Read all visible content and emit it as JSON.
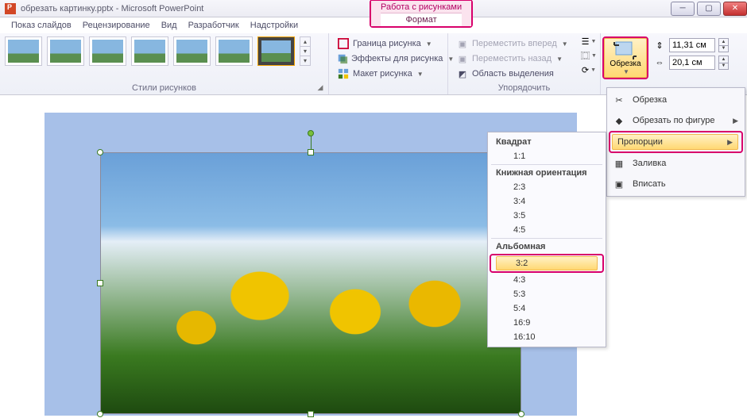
{
  "title": {
    "doc": "обрезать картинку.pptx",
    "app": "Microsoft PowerPoint",
    "sep": " - ",
    "contextual": "Работа с рисунками",
    "contextual_tab": "Формат"
  },
  "tabs": {
    "t1": "Показ слайдов",
    "t2": "Рецензирование",
    "t3": "Вид",
    "t4": "Разработчик",
    "t5": "Надстройки"
  },
  "ribbon": {
    "styles_label": "Стили рисунков",
    "arrange_label": "Упорядочить",
    "border": "Граница рисунка",
    "effects": "Эффекты для рисунка",
    "layout": "Макет рисунка",
    "bring_fwd": "Переместить вперед",
    "send_back": "Переместить назад",
    "selection": "Область выделения",
    "crop": "Обрезка",
    "height": "11,31 см",
    "width": "20,1 см"
  },
  "crop_menu": {
    "crop": "Обрезка",
    "shape": "Обрезать по фигуре",
    "aspect": "Пропорции",
    "fill": "Заливка",
    "fit": "Вписать"
  },
  "aspect": {
    "square": "Квадрат",
    "r11": "1:1",
    "portrait": "Книжная ориентация",
    "r23": "2:3",
    "r34": "3:4",
    "r35": "3:5",
    "r45": "4:5",
    "landscape": "Альбомная",
    "r32": "3:2",
    "r43": "4:3",
    "r53": "5:3",
    "r54": "5:4",
    "r169": "16:9",
    "r1610": "16:10"
  }
}
